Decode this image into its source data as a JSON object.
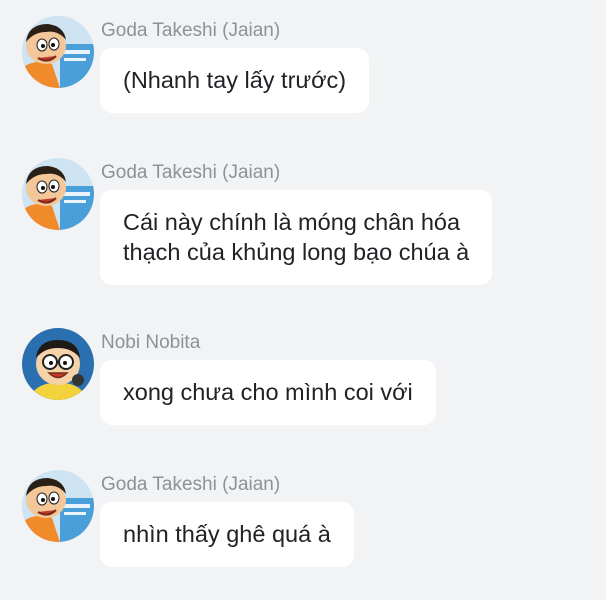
{
  "messages": [
    {
      "sender": "Goda Takeshi (Jaian)",
      "avatar": "jaian-avatar",
      "lines": [
        "(Nhanh tay lấy trước)"
      ]
    },
    {
      "sender": "Goda Takeshi (Jaian)",
      "avatar": "jaian-avatar",
      "lines": [
        "Cái này chính là móng chân hóa",
        "thạch của khủng long bạo chúa à"
      ]
    },
    {
      "sender": "Nobi Nobita",
      "avatar": "nobita-avatar",
      "lines": [
        "xong chưa cho mình coi với"
      ]
    },
    {
      "sender": "Goda Takeshi (Jaian)",
      "avatar": "jaian-avatar",
      "lines": [
        "nhìn thấy ghê quá à"
      ]
    }
  ],
  "colors": {
    "background": "#f2f3f5",
    "bubble": "#ffffff",
    "name_text": "#8e9196",
    "message_text": "#202226"
  }
}
